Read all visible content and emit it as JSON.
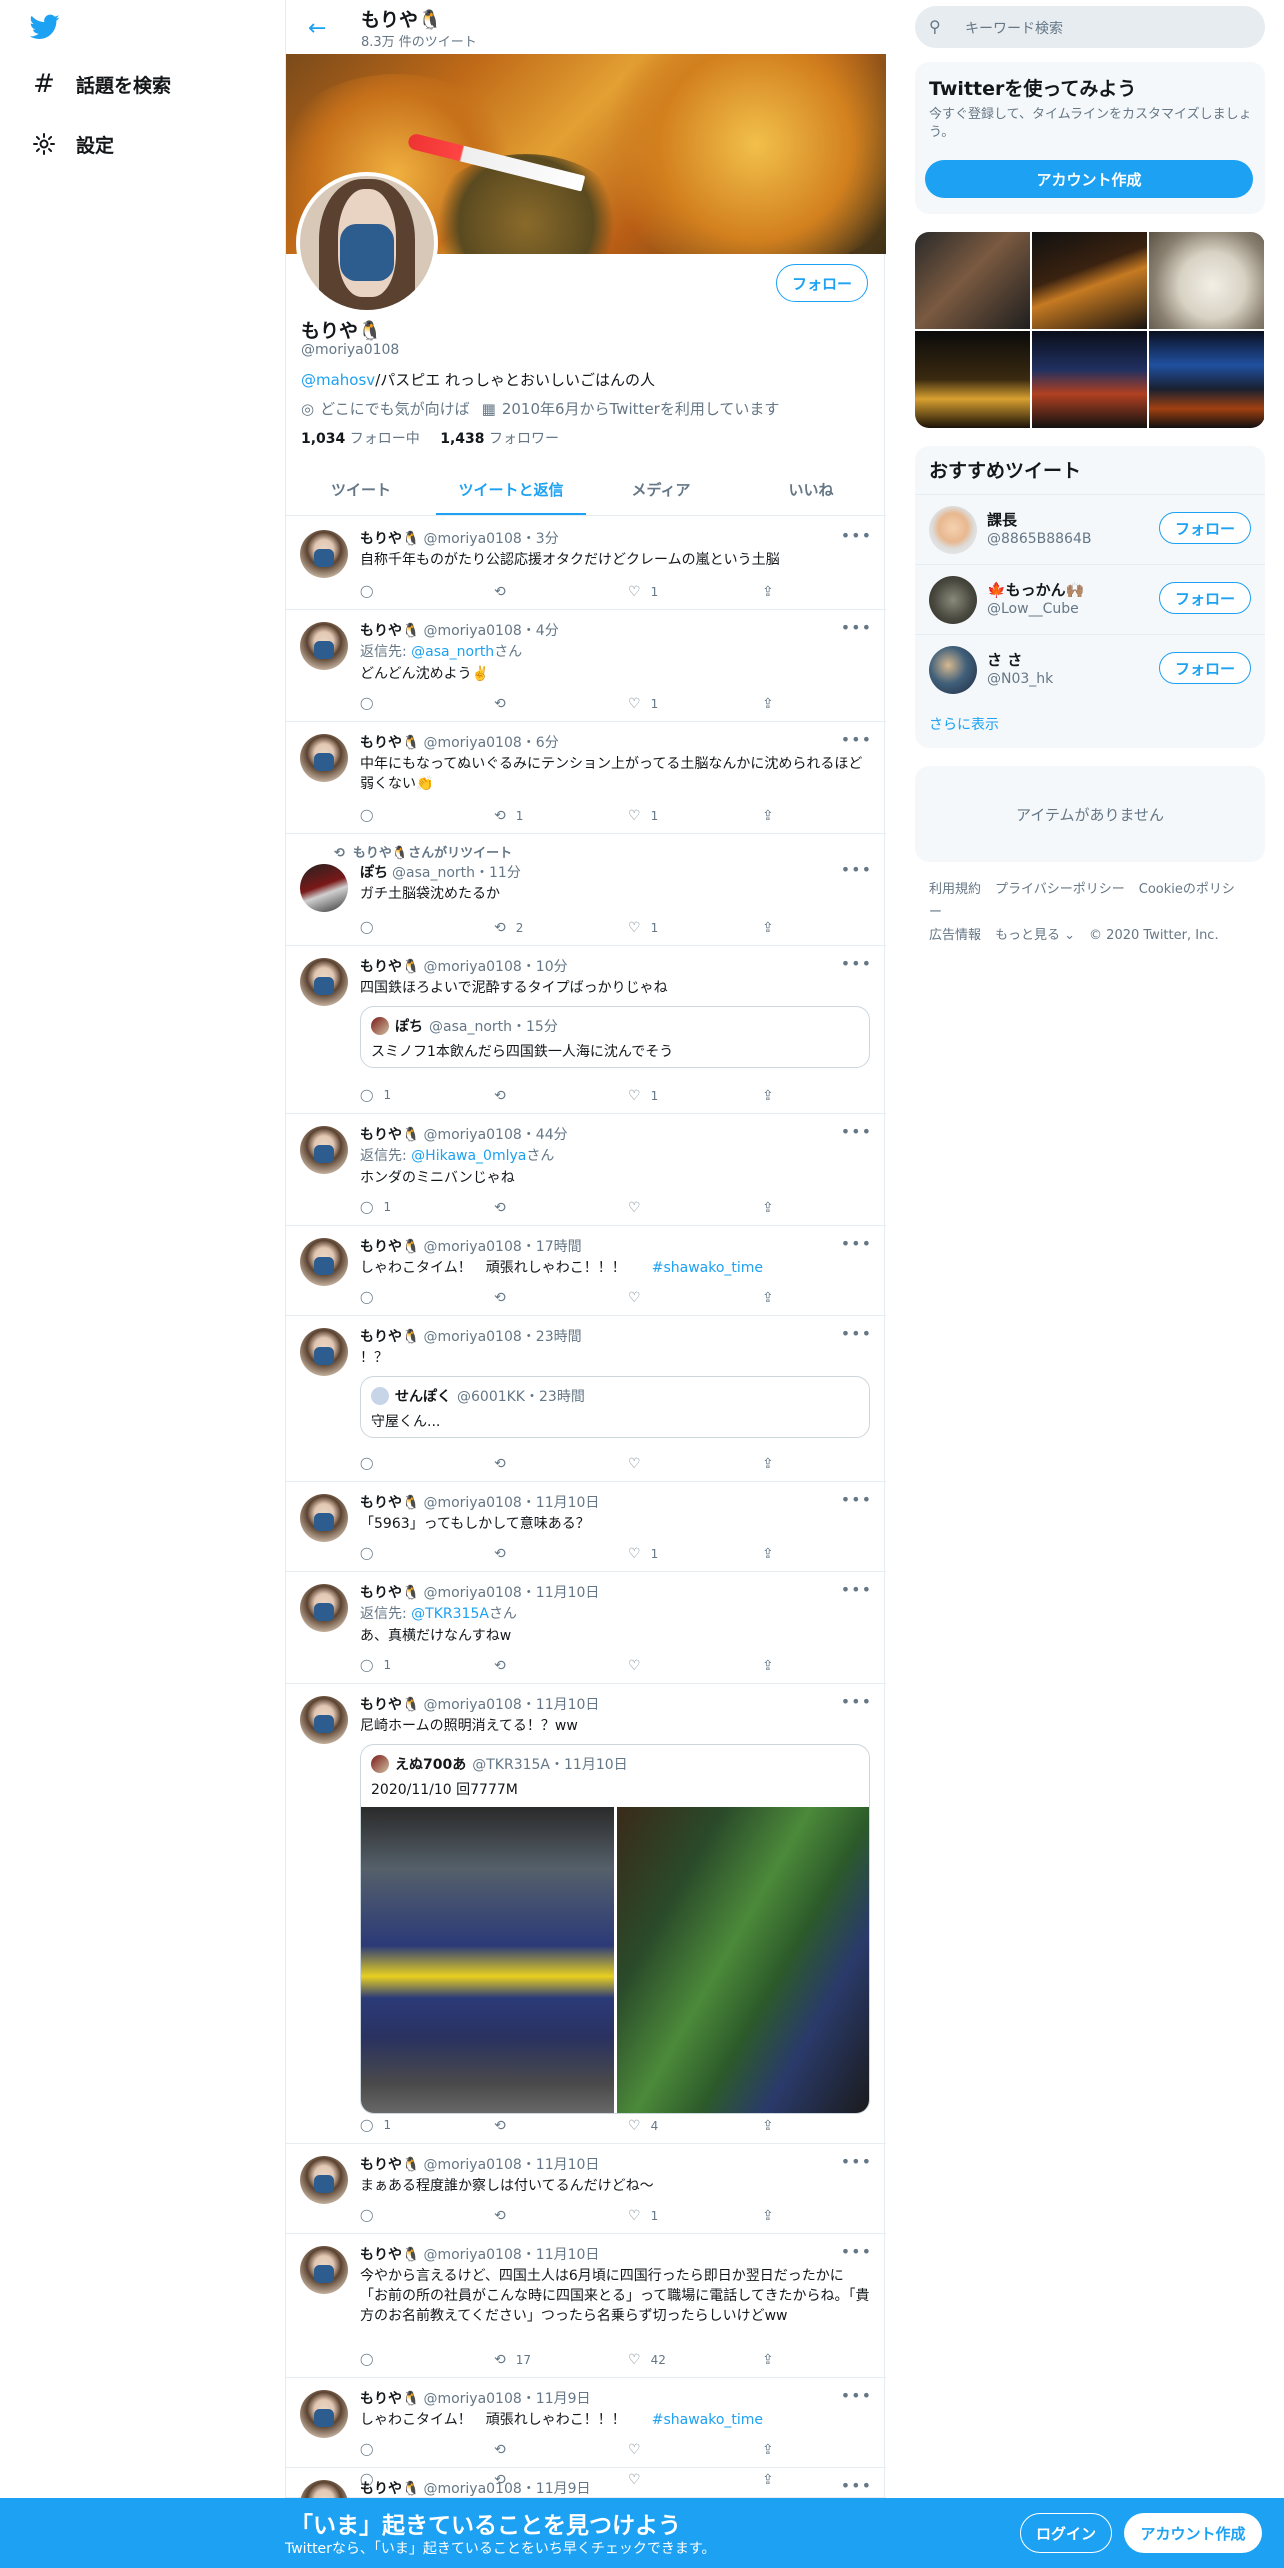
{
  "nav": {
    "items": [
      {
        "label": "話題を検索",
        "icon": "hashtag-icon"
      },
      {
        "label": "設定",
        "icon": "gear-icon"
      }
    ]
  },
  "header": {
    "name": "もりや🐧",
    "tweet_count": "8.3万 件のツイート"
  },
  "profile": {
    "name": "もりや🐧",
    "handle": "@moriya0108",
    "bio_mention": "@mahosv",
    "bio_rest": "/パスピエ れっしゃとおいしいごはんの人",
    "location": "どこにでも気が向けば",
    "joined": "2010年6月からTwitterを利用しています",
    "following_count": "1,034",
    "following_label": "フォロー中",
    "followers_count": "1,438",
    "followers_label": "フォロワー",
    "follow_button": "フォロー"
  },
  "tabs": [
    "ツイート",
    "ツイートと返信",
    "メディア",
    "いいね"
  ],
  "tweets": [
    {
      "name": "もりや🐧",
      "handle": "@moriya0108",
      "time": "・3分",
      "text": "自称千年ものがたり公認応援オタクだけどクレームの嵐という土脳",
      "reply": "",
      "retweet": "",
      "like": "1"
    },
    {
      "name": "もりや🐧",
      "handle": "@moriya0108",
      "time": "・4分",
      "reply_to_prefix": "返信先: ",
      "reply_to": "@asa_north",
      "reply_to_suffix": "さん",
      "text": "どんどん沈めよう✌️",
      "reply": "",
      "retweet": "",
      "like": "1"
    },
    {
      "name": "もりや🐧",
      "handle": "@moriya0108",
      "time": "・6分",
      "text": "中年にもなってぬいぐるみにテンション上がってる土脳なんかに沈められるほど弱くない👏",
      "reply": "",
      "retweet": "1",
      "like": "1"
    },
    {
      "rt_label": "もりや🐧さんがリツイート",
      "name": "ぽち",
      "handle": "@asa_north",
      "time": "・11分",
      "text": "ガチ土脳袋沈めたるか",
      "reply": "",
      "retweet": "2",
      "like": "1"
    },
    {
      "name": "もりや🐧",
      "handle": "@moriya0108",
      "time": "・10分",
      "text": "四国鉄ほろよいで泥酔するタイプばっかりじゃね",
      "quote": {
        "name": "ぽち",
        "handle": "@asa_north",
        "time": "・15分",
        "text": "スミノフ1本飲んだら四国鉄一人海に沈んでそう"
      },
      "reply": "1",
      "retweet": "",
      "like": "1"
    },
    {
      "name": "もりや🐧",
      "handle": "@moriya0108",
      "time": "・44分",
      "reply_to_prefix": "返信先: ",
      "reply_to": "@Hikawa_0mlya",
      "reply_to_suffix": "さん",
      "text": "ホンダのミニバンじゃね",
      "reply": "1",
      "retweet": "",
      "like": ""
    },
    {
      "name": "もりや🐧",
      "handle": "@moriya0108",
      "time": "・17時間",
      "text": "しゃわこタイム！　頑張れしゃわこ！！！　",
      "hashtag": "#shawako_time",
      "reply": "",
      "retweet": "",
      "like": ""
    },
    {
      "name": "もりや🐧",
      "handle": "@moriya0108",
      "time": "・23時間",
      "text": "！？",
      "quote": {
        "name": "せんぽく",
        "handle": "@6001KK",
        "time": "・23時間",
        "text": "守屋くん..."
      },
      "reply": "",
      "retweet": "",
      "like": ""
    },
    {
      "name": "もりや🐧",
      "handle": "@moriya0108",
      "time": "・11月10日",
      "text": "「5963」ってもしかして意味ある？",
      "reply": "",
      "retweet": "",
      "like": "1"
    },
    {
      "name": "もりや🐧",
      "handle": "@moriya0108",
      "time": "・11月10日",
      "reply_to_prefix": "返信先: ",
      "reply_to": "@TKR315A",
      "reply_to_suffix": "さん",
      "text": "あ、真横だけなんすねw",
      "reply": "1",
      "retweet": "",
      "like": ""
    },
    {
      "name": "もりや🐧",
      "handle": "@moriya0108",
      "time": "・11月10日",
      "text": "尼崎ホームの照明消えてる！？ww",
      "quote": {
        "name": "えぬ700あ",
        "handle": "@TKR315A",
        "time": "・11月10日",
        "text": "2020/11/10 回7777M"
      },
      "reply": "1",
      "retweet": "",
      "like": "4"
    },
    {
      "name": "もりや🐧",
      "handle": "@moriya0108",
      "time": "・11月10日",
      "text": "まぁある程度誰か察しは付いてるんだけどね〜",
      "reply": "",
      "retweet": "",
      "like": "1"
    },
    {
      "name": "もりや🐧",
      "handle": "@moriya0108",
      "time": "・11月10日",
      "text": "今やから言えるけど、四国土人は6月頃に四国行ったら即日か翌日だったかに「お前の所の社員がこんな時に四国来とる」って職場に電話してきたからね。「貴方のお名前教えてください」つったら名乗らず切ったらしいけどww",
      "reply": "",
      "retweet": "17",
      "like": "42"
    },
    {
      "name": "もりや🐧",
      "handle": "@moriya0108",
      "time": "・11月9日",
      "text": "しゃわこタイム！　頑張れしゃわこ！！！　",
      "hashtag": "#shawako_time",
      "reply": "",
      "retweet": "",
      "like": ""
    },
    {
      "name": "もりや🐧",
      "handle": "@moriya0108",
      "time": "・11月9日",
      "text": "",
      "reply": "",
      "retweet": "",
      "like": ""
    }
  ],
  "right": {
    "search_placeholder": "キーワード検索",
    "signup_title": "Twitterを使ってみよう",
    "signup_sub": "今すぐ登録して、タイムラインをカスタマイズしましょう。",
    "signup_button": "アカウント作成",
    "rec_title": "おすすめツイート",
    "recs": [
      {
        "name": "課長",
        "handle": "@8865B8864B",
        "button": "フォロー"
      },
      {
        "name": "🍁もっかん🙌🏽",
        "handle": "@Low__Cube",
        "button": "フォロー"
      },
      {
        "name": "さ さ",
        "handle": "@N03_hk",
        "button": "フォロー"
      }
    ],
    "show_more": "さらに表示",
    "no_items": "アイテムがありません",
    "footer": [
      "利用規約",
      "プライバシーポリシー",
      "Cookieのポリシー",
      "広告情報",
      "もっと見る ⌄",
      "© 2020 Twitter, Inc."
    ]
  },
  "bottom": {
    "title": "「いま」起きていることを見つけよう",
    "sub": "Twitterなら、「いま」起きていることをいち早くチェックできます。",
    "login": "ログイン",
    "signup": "アカウント作成"
  },
  "colors": {
    "accent": "#1da1f2",
    "text": "#14171a",
    "muted": "#657786",
    "border": "#e6ecf0"
  }
}
